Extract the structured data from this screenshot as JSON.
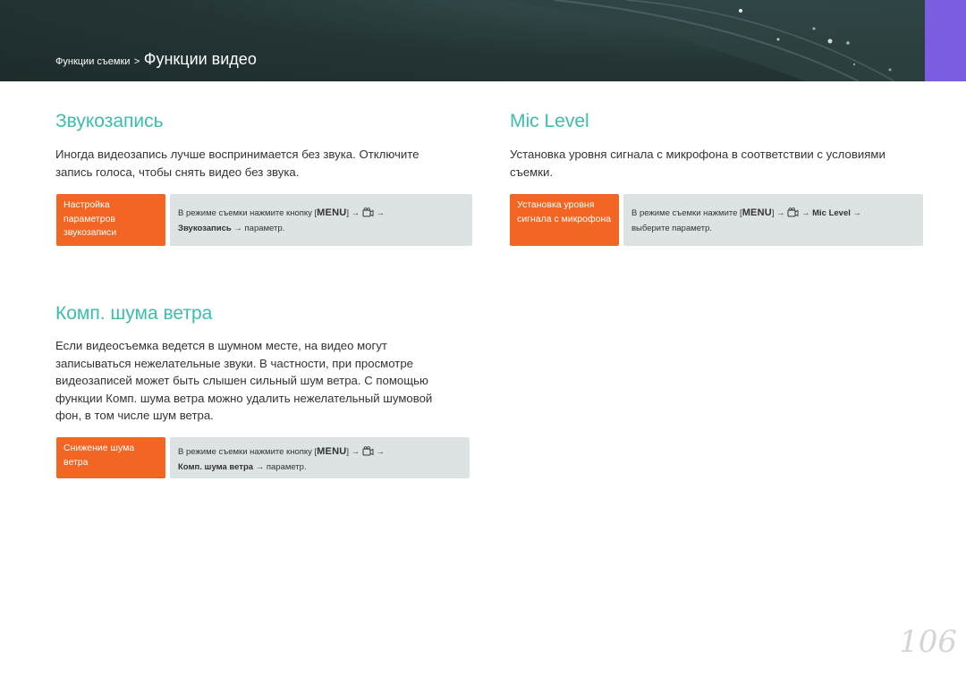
{
  "header": {
    "breadcrumb_parent": "Функции съемки",
    "breadcrumb_sep": ">",
    "breadcrumb_current": "Функции видео",
    "accent_color": "#7b5de0"
  },
  "sections": {
    "audio": {
      "title": "Звукозапись",
      "body": "Иногда видеозапись лучше воспринимается без звука. Отключите запись голоса, чтобы снять видео без звука.",
      "tag_label": "Настройка параметров звукозаписи",
      "instr_prefix": "В режиме съемки нажмите кнопку [",
      "menu_key": "MENU",
      "instr_mid": "] →",
      "instr_arrow": "→",
      "instr_item": "Звукозапись",
      "instr_suffix": "→ параметр."
    },
    "mic": {
      "title": "Mic Level",
      "body": "Установка уровня сигнала с микрофона в соответствии с условиями съемки.",
      "tag_label": "Установка уровня сигнала с микрофона",
      "instr_prefix": "В режиме съемки нажмите [",
      "menu_key": "MENU",
      "instr_mid": "] →",
      "instr_arrow": "→",
      "instr_item": "Mic Level",
      "instr_arrow2": "→",
      "instr_suffix": "выберите параметр."
    },
    "wind": {
      "title": "Комп. шума ветра",
      "body": "Если видеосъемка ведется в шумном месте, на видео могут записываться нежелательные звуки. В частности, при просмотре видеозаписей может быть слышен сильный шум ветра. С помощью функции Комп. шума ветра можно удалить нежелательный шумовой фон, в том числе шум ветра.",
      "tag_label": "Снижение шума ветра",
      "instr_prefix": "В режиме съемки нажмите кнопку [",
      "menu_key": "MENU",
      "instr_mid": "] →",
      "instr_arrow": "→",
      "instr_item": "Комп. шума ветра",
      "instr_suffix": "→ параметр."
    }
  },
  "icons": {
    "movie": "video-camera-icon"
  },
  "colors": {
    "title": "#3bbfa9",
    "tag": "#f26522",
    "instr_bg": "#dde2e3"
  },
  "page_number": "106"
}
